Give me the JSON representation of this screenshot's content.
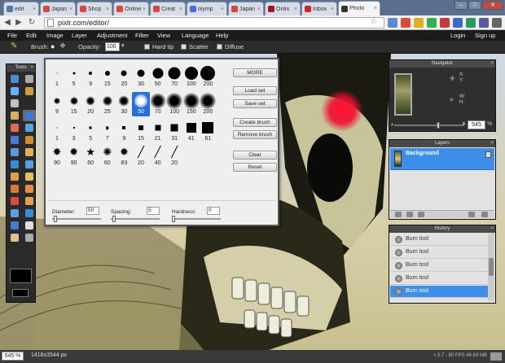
{
  "browser": {
    "tabs": [
      {
        "label": "edit",
        "color": "#4a7ab0"
      },
      {
        "label": "Japan",
        "color": "#d04a3e"
      },
      {
        "label": "Shop",
        "color": "#d04a3e"
      },
      {
        "label": "Online",
        "color": "#d04a3e"
      },
      {
        "label": "Creat",
        "color": "#d04a3e"
      },
      {
        "label": "olymp",
        "color": "#4a6fd0"
      },
      {
        "label": "Japan",
        "color": "#d04a3e"
      },
      {
        "label": "Onlin",
        "color": "#a01818"
      },
      {
        "label": "Inbox",
        "color": "#c42a20"
      },
      {
        "label": "Photo",
        "color": "#333333",
        "active": true
      }
    ],
    "url": "pixlr.com/editor/"
  },
  "menubar": {
    "items": [
      "File",
      "Edit",
      "Image",
      "Layer",
      "Adjustment",
      "Filter",
      "View",
      "Language",
      "Help"
    ],
    "login": "Login",
    "signup": "Sign up"
  },
  "options": {
    "brush_label": "Brush:",
    "opacity_label": "Opacity:",
    "opacity_value": "100",
    "hard_tip": "Hard tip",
    "scatter": "Scatter",
    "diffuse": "Diffuse"
  },
  "tools_panel": {
    "title": "Tools"
  },
  "brush_palette": {
    "rows": [
      [
        "1",
        "5",
        "9",
        "15",
        "20",
        "30",
        "50",
        "70",
        "100",
        "200"
      ],
      [
        "9",
        "15",
        "20",
        "25",
        "30",
        "50",
        "70",
        "100",
        "150",
        "200"
      ],
      [
        "1",
        "3",
        "5",
        "7",
        "9",
        "15",
        "21",
        "31",
        "41",
        "61"
      ],
      [
        "90",
        "90",
        "60",
        "60",
        "83",
        "20",
        "40",
        "20"
      ]
    ],
    "selected_size": "50",
    "buttons": {
      "more": "MORE",
      "load": "Load set",
      "save": "Save set",
      "create": "Create brush",
      "remove": "Remove brush",
      "clear": "Clear",
      "reset": "Reset"
    },
    "diameter_label": "Diameter:",
    "diameter_value": "50",
    "spacing_label": "Spacing:",
    "spacing_value": "5",
    "hardness_label": "Hardness:",
    "hardness_value": "0"
  },
  "navigator": {
    "title": "Navigator",
    "x": "X:",
    "y": "Y:",
    "w": "W:",
    "h": "H:",
    "zoom": "545",
    "zoom_unit": "%"
  },
  "layers": {
    "title": "Layers",
    "layer_name": "Background"
  },
  "history": {
    "title": "History",
    "items": [
      "Burn tool",
      "Burn tool",
      "Burn tool",
      "Burn tool",
      "Burn tool"
    ],
    "selected_index": 4
  },
  "status": {
    "zoom": "545 %",
    "dimensions": "1418x3544 px",
    "fps": "v 5.7 - 80 FPS 46.63 MB"
  },
  "colors": {
    "accent": "#3d8ee6",
    "panel_dark": "#2a2a2a",
    "menubar": "#1c1c1c",
    "red_paint": "#e8102a"
  }
}
